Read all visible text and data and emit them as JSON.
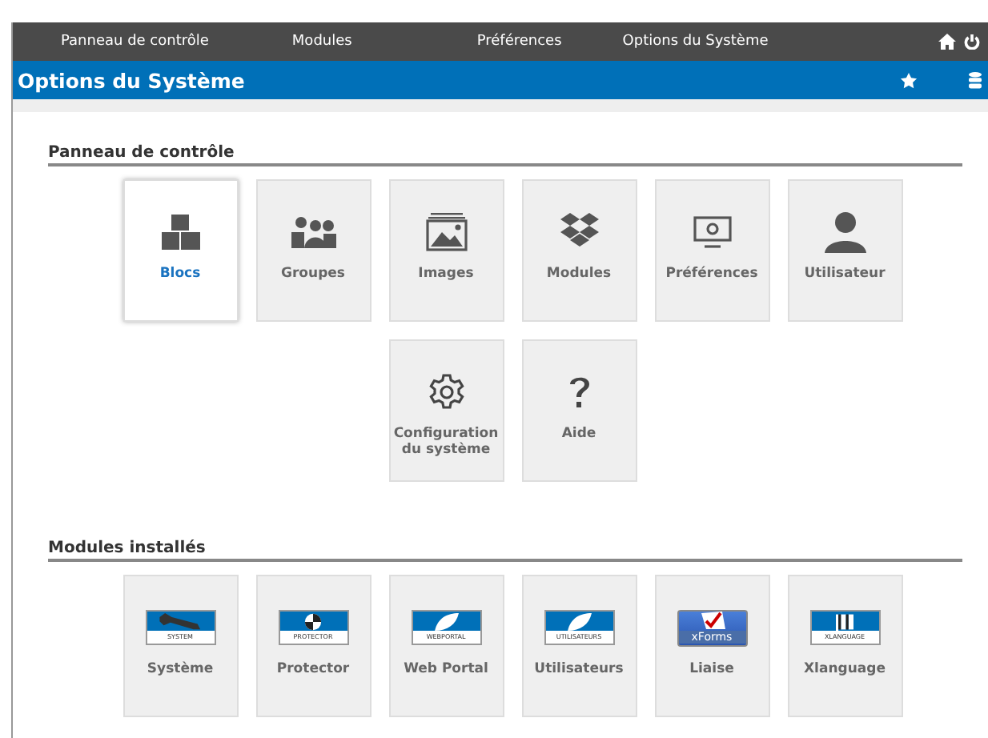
{
  "top_nav": {
    "items": [
      "Panneau de contrôle",
      "Modules",
      "Préférences",
      "Options du Système"
    ]
  },
  "header": {
    "title": "Options du Système"
  },
  "sections": [
    {
      "title": "Panneau de contrôle",
      "tiles": [
        {
          "label": "Blocs",
          "kind": "blocks",
          "selected": true
        },
        {
          "label": "Groupes",
          "kind": "groups",
          "selected": false
        },
        {
          "label": "Images",
          "kind": "images",
          "selected": false
        },
        {
          "label": "Modules",
          "kind": "modules",
          "selected": false
        },
        {
          "label": "Préférences",
          "kind": "monitor",
          "selected": false
        },
        {
          "label": "Utilisateur",
          "kind": "user",
          "selected": false
        },
        {
          "label": "Configuration du système",
          "kind": "gear",
          "selected": false
        },
        {
          "label": "Aide",
          "kind": "help",
          "selected": false
        }
      ]
    },
    {
      "title": "Modules installés",
      "tiles": [
        {
          "label": "Système",
          "kind": "wrench",
          "logo_text": "SYSTEM",
          "selected": false
        },
        {
          "label": "Protector",
          "kind": "shield",
          "logo_text": "PROTECTOR",
          "selected": false
        },
        {
          "label": "Web Portal",
          "kind": "leaf",
          "logo_text": "WEBPORTAL",
          "selected": false
        },
        {
          "label": "Utilisateurs",
          "kind": "leaf",
          "logo_text": "UTILISATEURS",
          "selected": false
        },
        {
          "label": "Liaise",
          "kind": "xforms",
          "logo_text": "xForms",
          "selected": false
        },
        {
          "label": "Xlanguage",
          "kind": "flag",
          "logo_text": "XLANGUAGE",
          "selected": false
        }
      ]
    }
  ]
}
